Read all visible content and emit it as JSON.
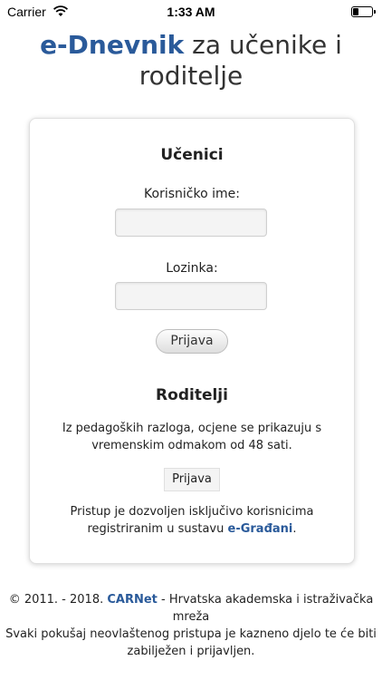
{
  "status_bar": {
    "carrier": "Carrier",
    "time": "1:33 AM",
    "wifi_icon": "wifi-icon",
    "battery_icon": "battery-icon"
  },
  "header": {
    "brand": "e-Dnevnik",
    "title_rest": "za učenike i roditelje"
  },
  "students": {
    "heading": "Učenici",
    "username_label": "Korisničko ime:",
    "username_value": "",
    "password_label": "Lozinka:",
    "password_value": "",
    "login_button": "Prijava"
  },
  "parents": {
    "heading": "Roditelji",
    "notice": "Iz pedagoških razloga, ocjene se prikazuju s vremenskim odmakom od 48 sati.",
    "login_button": "Prijava",
    "access_text": "Pristup je dozvoljen isključivo korisnicima registriranim u sustavu",
    "access_link": "e-Građani",
    "access_end": "."
  },
  "footer": {
    "copyright": "© 2011. - 2018.",
    "org_link": "CARNet",
    "org_rest": "- Hrvatska akademska i istraživačka mreža",
    "warning": "Svaki pokušaj neovlaštenog pristupa je kazneno djelo te će biti zabilježen i prijavljen."
  },
  "colors": {
    "brand": "#2a5a9a",
    "background": "#ffffff",
    "card_border": "#e0e0e0"
  }
}
